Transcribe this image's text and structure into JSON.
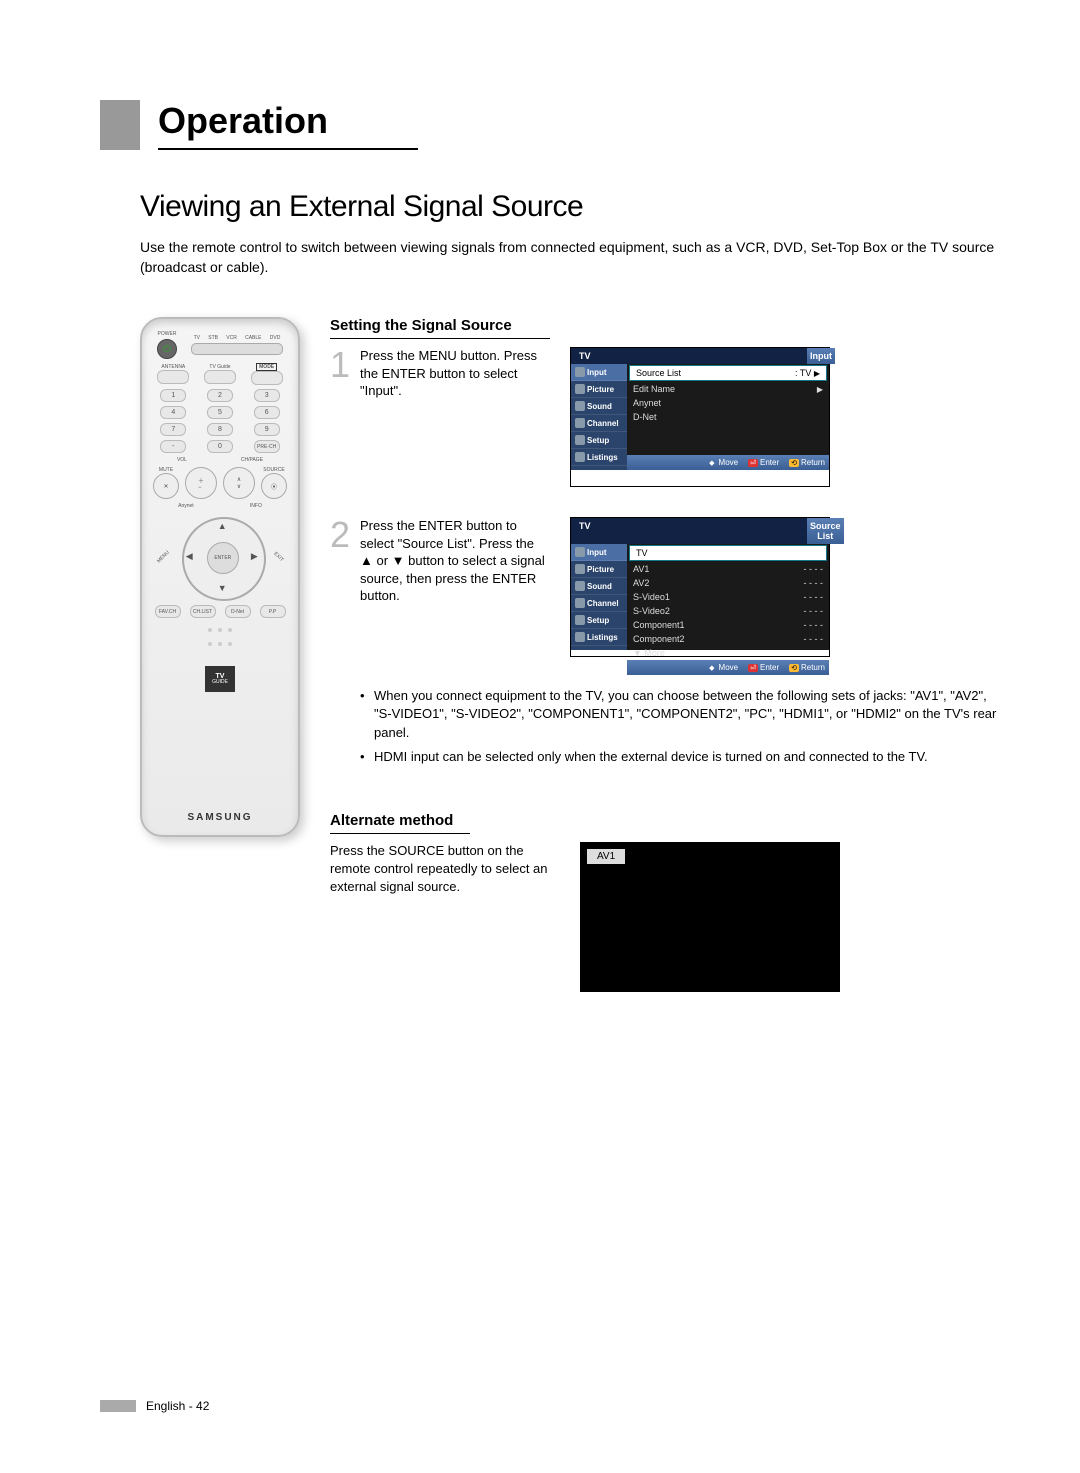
{
  "section_title": "Operation",
  "page_title": "Viewing an External Signal Source",
  "intro": "Use the remote control to switch between viewing signals from connected equipment, such as a VCR, DVD, Set-Top Box or the TV source (broadcast or cable).",
  "remote": {
    "top_labels": [
      "POWER",
      "TV",
      "STB",
      "VCR",
      "CABLE",
      "DVD"
    ],
    "row2": [
      "ANTENNA",
      "TV Guide",
      "MODE"
    ],
    "numpad": [
      "1",
      "2",
      "3",
      "4",
      "5",
      "6",
      "7",
      "8",
      "9",
      "-",
      "0",
      "PRE-CH"
    ],
    "vol_label": "VOL",
    "ch_label": "CH/PAGE",
    "mute": "MUTE",
    "source": "SOURCE",
    "anynet": "Anynet",
    "info": "INFO",
    "menu": "MENU",
    "exit": "EXIT",
    "enter": "ENTER",
    "bottom_row": [
      "FAV.CH",
      "CH.LIST",
      "D-Net",
      "P.P"
    ],
    "tvguide": "TV GUIDE",
    "brand": "SAMSUNG"
  },
  "subheading1": "Setting the Signal Source",
  "step1": {
    "num": "1",
    "text": "Press the MENU button. Press the ENTER button to select \"Input\"."
  },
  "osd1": {
    "tv": "TV",
    "title": "Input",
    "side": [
      "Input",
      "Picture",
      "Sound",
      "Channel",
      "Setup",
      "Listings"
    ],
    "rows": [
      {
        "label": "Source List",
        "value": ": TV",
        "arrow": true,
        "sel": true
      },
      {
        "label": "Edit Name",
        "value": "",
        "arrow": true
      },
      {
        "label": "Anynet",
        "value": "",
        "arrow": false
      },
      {
        "label": "D-Net",
        "value": "",
        "arrow": false
      }
    ],
    "hints": {
      "move": "Move",
      "enter": "Enter",
      "return": "Return"
    }
  },
  "step2": {
    "num": "2",
    "text": "Press the ENTER button to select \"Source List\". Press the ▲ or ▼ button to select a signal source, then press the ENTER button.",
    "bullets": [
      "When you connect equipment to the TV, you can choose between the following sets of jacks: \"AV1\", \"AV2\", \"S-VIDEO1\", \"S-VIDEO2\", \"COMPONENT1\", \"COMPONENT2\", \"PC\", \"HDMI1\", or \"HDMI2\" on the TV's rear panel.",
      "HDMI input can be selected only when the external device is turned on and connected to the TV."
    ]
  },
  "osd2": {
    "tv": "TV",
    "title": "Source List",
    "side": [
      "Input",
      "Picture",
      "Sound",
      "Channel",
      "Setup",
      "Listings"
    ],
    "rows": [
      {
        "label": "TV",
        "value": "",
        "sel": true
      },
      {
        "label": "AV1",
        "value": "- - - -"
      },
      {
        "label": "AV2",
        "value": "- - - -"
      },
      {
        "label": "S-Video1",
        "value": "- - - -"
      },
      {
        "label": "S-Video2",
        "value": "- - - -"
      },
      {
        "label": "Component1",
        "value": "- - - -"
      },
      {
        "label": "Component2",
        "value": "- - - -"
      },
      {
        "label": "▼ More",
        "value": ""
      }
    ],
    "hints": {
      "move": "Move",
      "enter": "Enter",
      "return": "Return"
    }
  },
  "alt_heading": "Alternate method",
  "alt_text": "Press the SOURCE button on the remote control repeatedly to select an external signal source.",
  "alt_badge": "AV1",
  "footer": "English - 42"
}
